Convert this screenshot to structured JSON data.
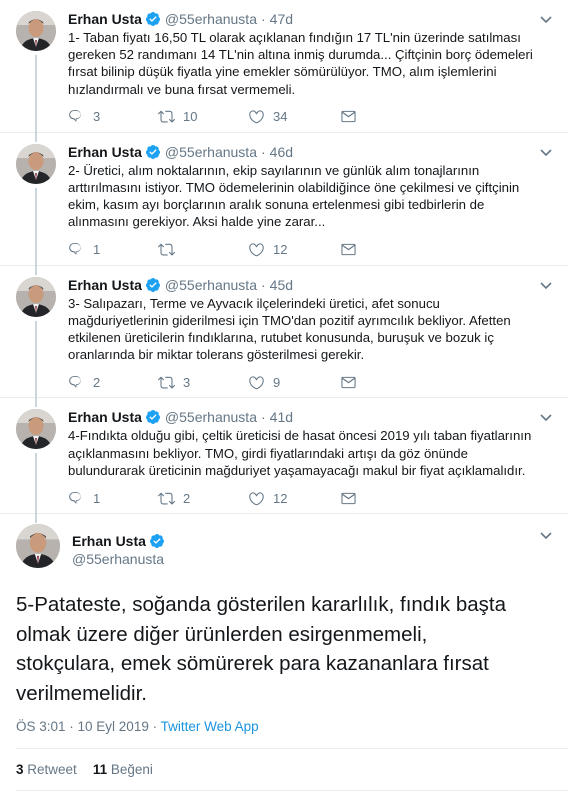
{
  "colors": {
    "accent": "#1da1f2",
    "muted": "#657786",
    "text": "#14171a",
    "border": "#e6ecf0"
  },
  "icons": {
    "reply": "reply-icon",
    "retweet": "retweet-icon",
    "like": "heart-icon",
    "dm": "envelope-icon",
    "verified": "verified-badge-icon",
    "more": "chevron-down-icon"
  },
  "tweets": [
    {
      "name": "Erhan Usta",
      "handle": "@55erhanusta",
      "sep": "·",
      "age": "47d",
      "text": "1- Taban fiyatı 16,50 TL olarak açıklanan fındığın 17 TL'nin üzerinde satılması gereken 52 randımanı 14 TL'nin altına inmiş durumda... Çiftçinin borç ödemeleri fırsat bilinip düşük fiyatla yine emekler sömürülüyor. TMO, alım işlemlerini hızlandırmalı ve buna fırsat vermemeli.",
      "replies": "3",
      "retweets": "10",
      "likes": "34"
    },
    {
      "name": "Erhan Usta",
      "handle": "@55erhanusta",
      "sep": "·",
      "age": "46d",
      "text": "2- Üretici, alım noktalarının, ekip sayılarının ve günlük alım tonajlarının arttırılmasını istiyor. TMO ödemelerinin olabildiğince öne çekilmesi ve çiftçinin ekim, kasım ayı borçlarının aralık sonuna ertelenmesi gibi tedbirlerin de alınmasını gerekiyor. Aksi halde yine zarar...",
      "replies": "1",
      "retweets": "",
      "likes": "12"
    },
    {
      "name": "Erhan Usta",
      "handle": "@55erhanusta",
      "sep": "·",
      "age": "45d",
      "text": "3- Salıpazarı, Terme ve Ayvacık ilçelerindeki üretici, afet sonucu mağduriyetlerinin giderilmesi için TMO'dan pozitif ayrımcılık bekliyor. Afetten etkilenen üreticilerin fındıklarına, rutubet konusunda, buruşuk ve bozuk iç oranlarında bir miktar tolerans gösterilmesi gerekir.",
      "replies": "2",
      "retweets": "3",
      "likes": "9"
    },
    {
      "name": "Erhan Usta",
      "handle": "@55erhanusta",
      "sep": "·",
      "age": "41d",
      "text": "4-Fındıkta olduğu gibi, çeltik üreticisi de hasat öncesi 2019 yılı taban fiyatlarının açıklanmasını bekliyor. TMO, girdi fiyatlarındaki artışı da göz önünde bulundurarak üreticinin mağduriyet yaşamayacağı makul bir fiyat açıklamalıdır.",
      "replies": "1",
      "retweets": "2",
      "likes": "12"
    }
  ],
  "main": {
    "name": "Erhan Usta",
    "handle": "@55erhanusta",
    "text": "5-Patateste, soğanda gösterilen kararlılık, fındık başta olmak üzere diğer ürünlerden esirgenmemeli, stokçulara, emek sömürerek para kazananlara fırsat verilmemelidir.",
    "time": "ÖS 3:01 · 10 Eyl 2019 · ",
    "app": "Twitter Web App",
    "retweet_count": "3",
    "retweet_label": "Retweet",
    "like_count": "11",
    "like_label": "Beğeni"
  }
}
